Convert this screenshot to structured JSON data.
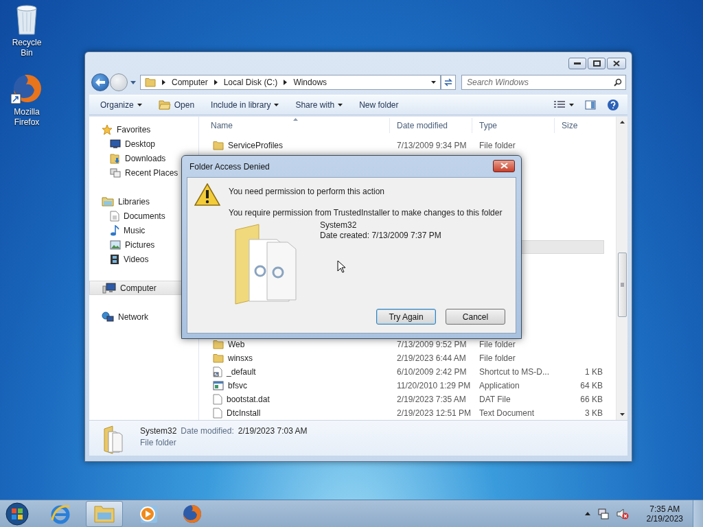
{
  "desktop_icons": [
    {
      "label": "Recycle Bin",
      "kind": "recycle-bin"
    },
    {
      "label": "Mozilla Firefox",
      "kind": "firefox"
    }
  ],
  "explorer": {
    "breadcrumb": [
      "Computer",
      "Local Disk (C:)",
      "Windows"
    ],
    "search": {
      "placeholder": "Search Windows"
    },
    "toolbar": [
      {
        "label": "Organize",
        "kind": "menu"
      },
      {
        "label": "Open",
        "kind": "open"
      },
      {
        "label": "Include in library",
        "kind": "menu"
      },
      {
        "label": "Share with",
        "kind": "menu"
      },
      {
        "label": "New folder",
        "kind": "plain"
      }
    ],
    "nav": [
      {
        "label": "Favorites",
        "kind": "star",
        "selected": false,
        "children": [
          {
            "label": "Desktop",
            "kind": "desktop",
            "selected": false
          },
          {
            "label": "Downloads",
            "kind": "downloads",
            "selected": false
          },
          {
            "label": "Recent Places",
            "kind": "recent",
            "selected": false
          }
        ]
      },
      {
        "label": "Libraries",
        "kind": "libraries",
        "selected": false,
        "children": [
          {
            "label": "Documents",
            "kind": "documents",
            "selected": false
          },
          {
            "label": "Music",
            "kind": "music",
            "selected": false
          },
          {
            "label": "Pictures",
            "kind": "pictures",
            "selected": false
          },
          {
            "label": "Videos",
            "kind": "videos",
            "selected": false
          }
        ]
      },
      {
        "label": "Computer",
        "kind": "computer",
        "selected": true
      },
      {
        "label": "Network",
        "kind": "network",
        "selected": false
      }
    ],
    "columns": [
      "Name",
      "Date modified",
      "Type",
      "Size"
    ],
    "rows_top": [
      {
        "name": "ServiceProfiles",
        "date": "7/13/2009 9:34 PM",
        "type": "File folder",
        "kind": "folder"
      }
    ],
    "rows_bottom": [
      {
        "name": "Web",
        "date": "7/13/2009 9:52 PM",
        "type": "File folder",
        "kind": "folder"
      },
      {
        "name": "winsxs",
        "date": "2/19/2023 6:44 AM",
        "type": "File folder",
        "kind": "folder"
      },
      {
        "name": "_default",
        "date": "6/10/2009 2:42 PM",
        "type": "Shortcut to MS-D...",
        "size": "1 KB",
        "kind": "shortcut"
      },
      {
        "name": "bfsvc",
        "date": "11/20/2010 1:29 PM",
        "type": "Application",
        "size": "64 KB",
        "kind": "app"
      },
      {
        "name": "bootstat.dat",
        "date": "2/19/2023 7:35 AM",
        "type": "DAT File",
        "size": "66 KB",
        "kind": "file"
      },
      {
        "name": "DtcInstall",
        "date": "2/19/2023 12:51 PM",
        "type": "Text Document",
        "size": "3 KB",
        "kind": "file"
      }
    ],
    "details": {
      "name": "System32",
      "label": "Date modified:",
      "value": "2/19/2023 7:03 AM",
      "type": "File folder"
    }
  },
  "dialog": {
    "title": "Folder Access Denied",
    "heading": "You need permission to perform this action",
    "message": "You require permission from TrustedInstaller to make changes to this folder",
    "item": {
      "name": "System32",
      "created": "Date created: 7/13/2009 7:37 PM"
    },
    "buttons": [
      {
        "label": "Try Again",
        "default": true
      },
      {
        "label": "Cancel",
        "default": false
      }
    ]
  },
  "taskbar": {
    "apps": [
      {
        "kind": "ie",
        "active": false
      },
      {
        "kind": "explorer",
        "active": true
      },
      {
        "kind": "media",
        "active": false
      },
      {
        "kind": "firefox",
        "active": false
      }
    ],
    "volume_muted": true,
    "time": "7:35 AM",
    "date": "2/19/2023"
  }
}
